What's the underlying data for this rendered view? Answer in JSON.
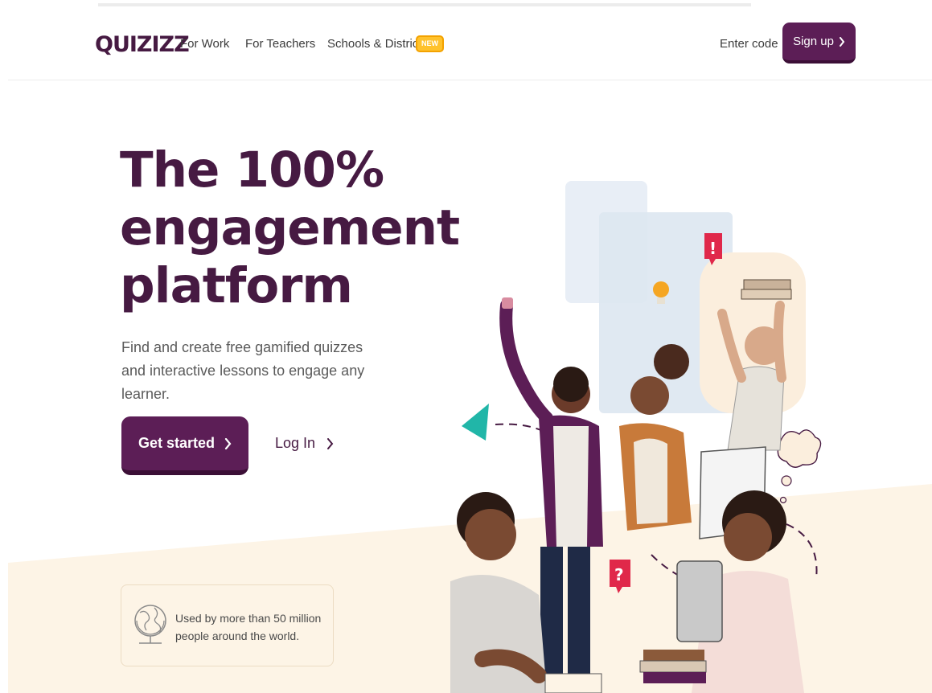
{
  "header": {
    "logo": "QUIZIZZ",
    "nav": [
      {
        "label": "For Work"
      },
      {
        "label": "For Teachers"
      },
      {
        "label": "Schools & Districts"
      }
    ],
    "new_badge": "NEW",
    "enter_code": "Enter code",
    "signup_label": "Sign up"
  },
  "hero": {
    "headline": [
      "The 100%",
      "engagement",
      "platform"
    ],
    "subtitle": "Find and create free gamified quizzes and interactive lessons to engage any learner.",
    "get_started_label": "Get started",
    "login_label": "Log In"
  },
  "stats": {
    "text": "Used by more than 50 million people around the world."
  },
  "illustration": {
    "bubble_exclaim": "!",
    "bubble_question": "?"
  },
  "colors": {
    "brand": "#461a42",
    "button": "#5c1e56",
    "badge": "#ffc22c",
    "beige": "#fdf4e6",
    "accent_red": "#e0284a",
    "accent_teal": "#21b6a8"
  },
  "icons": {
    "chevron": "chevron-right-icon",
    "globe": "globe-icon",
    "paper_plane": "paper-plane-icon",
    "lightbulb": "lightbulb-icon"
  }
}
